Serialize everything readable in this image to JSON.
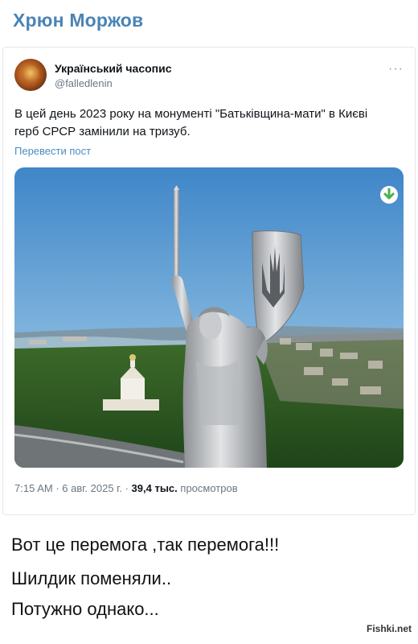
{
  "page": {
    "title": "Хрюн Моржов"
  },
  "post": {
    "author": {
      "name": "Український часопис",
      "handle": "@falledlenin"
    },
    "more_icon": "more-horizontal-icon",
    "text": "В цей день 2023 року на монументі \"Батьківщина-мати\" в Києві герб СРСР замінили на тризуб.",
    "translate_label": "Перевести пост",
    "media": {
      "download_icon": "download-arrow-icon"
    },
    "meta": {
      "time": "7:15 AM",
      "separator": "·",
      "date": "6 авг. 2025 г.",
      "views_count": "39,4 тыс.",
      "views_label": "просмотров"
    }
  },
  "captions": [
    "Вот це перемога ,так перемога!!!",
    "Шилдик поменяли..",
    "Потужно однако..."
  ],
  "watermark": "Fishki.net",
  "colors": {
    "title": "#4a84b4",
    "link": "#4a8cc4",
    "muted": "#6b7780",
    "download_green": "#4caf50"
  }
}
